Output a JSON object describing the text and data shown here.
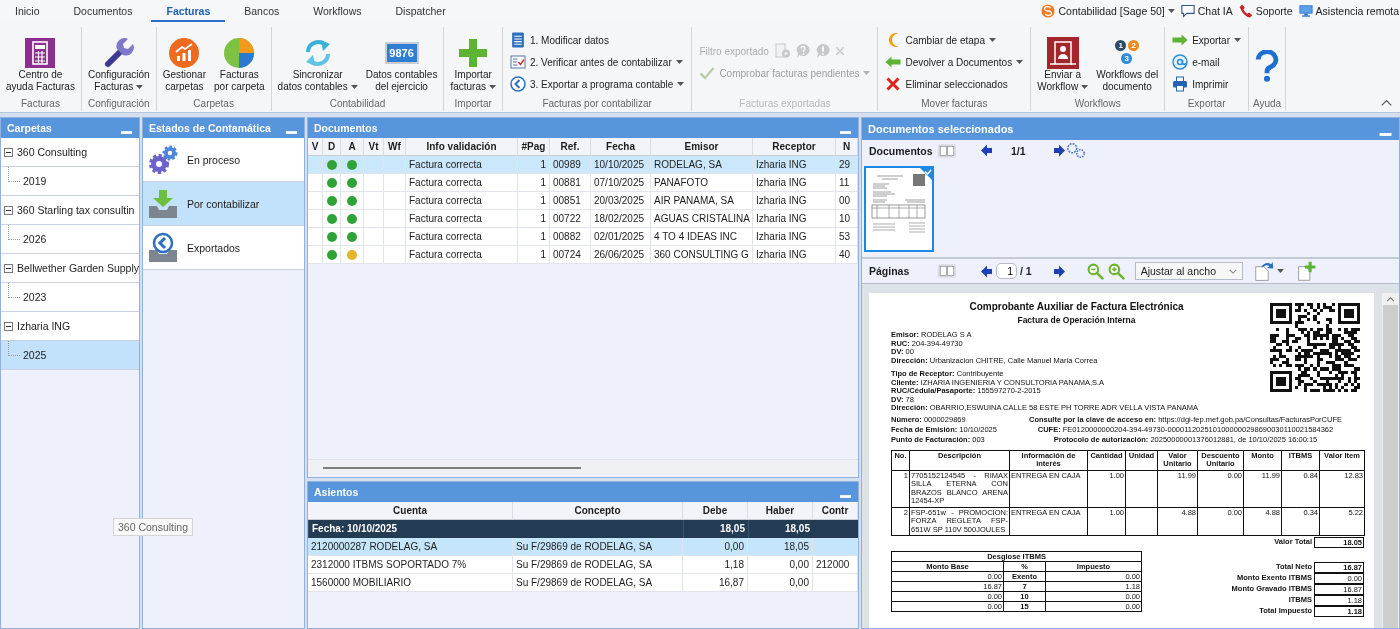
{
  "top_tabs": [
    {
      "label": "Inicio",
      "selected": false
    },
    {
      "label": "Documentos",
      "selected": false
    },
    {
      "label": "Facturas",
      "selected": true
    },
    {
      "label": "Bancos",
      "selected": false
    },
    {
      "label": "Workflows",
      "selected": false
    },
    {
      "label": "Dispatcher",
      "selected": false
    }
  ],
  "top_links": [
    {
      "label": "Contabilidad [Sage 50]",
      "dropdown": true
    },
    {
      "label": "Chat IA",
      "dropdown": false
    },
    {
      "label": "Soporte",
      "dropdown": false
    },
    {
      "label": "Asistencia remota",
      "dropdown": false
    }
  ],
  "ribbon": {
    "groups": [
      {
        "label": "Facturas",
        "disabled": false,
        "items": [
          {
            "kind": "large",
            "lines": [
              "Centro de",
              "ayuda Facturas"
            ],
            "dropdown": false
          }
        ]
      },
      {
        "label": "Configuración",
        "disabled": false,
        "items": [
          {
            "kind": "large",
            "lines": [
              "Configuración",
              "Facturas"
            ],
            "dropdown": true
          }
        ]
      },
      {
        "label": "Carpetas",
        "disabled": false,
        "items": [
          {
            "kind": "large",
            "lines": [
              "Gestionar",
              "carpetas"
            ],
            "dropdown": false
          },
          {
            "kind": "large",
            "lines": [
              "Facturas",
              "por carpeta"
            ],
            "dropdown": false
          }
        ]
      },
      {
        "label": "Contabilidad",
        "disabled": false,
        "items": [
          {
            "kind": "large",
            "lines": [
              "Sincronizar",
              "datos contables"
            ],
            "dropdown": true
          },
          {
            "kind": "large",
            "display": "9876",
            "lines": [
              "Datos contables",
              "del ejercicio"
            ],
            "dropdown": false
          }
        ]
      },
      {
        "label": "Importar",
        "disabled": false,
        "items": [
          {
            "kind": "large",
            "lines": [
              "Importar",
              "facturas"
            ],
            "dropdown": true
          }
        ]
      },
      {
        "label": "Facturas por contabilizar",
        "disabled": false,
        "items": [
          {
            "kind": "small",
            "label": "1. Modificar datos",
            "dropdown": false
          },
          {
            "kind": "small",
            "label": "2. Verificar antes de contabilizar",
            "dropdown": true
          },
          {
            "kind": "small",
            "label": "3. Exportar a programa contable",
            "dropdown": true
          }
        ]
      },
      {
        "label": "Facturas exportadas",
        "disabled": true,
        "items": [
          {
            "kind": "tools",
            "label": "Filtro exportado",
            "dropdown": false
          },
          {
            "kind": "small",
            "label": "Comprobar facturas pendientes",
            "dropdown": true
          }
        ]
      },
      {
        "label": "Mover facturas",
        "disabled": false,
        "items": [
          {
            "kind": "small",
            "label": "Cambiar de etapa",
            "dropdown": true
          },
          {
            "kind": "small",
            "label": "Devolver a Documentos",
            "dropdown": true
          },
          {
            "kind": "small",
            "label": "Eliminar seleccionados",
            "dropdown": false
          }
        ]
      },
      {
        "label": "Workflows",
        "disabled": false,
        "items": [
          {
            "kind": "large",
            "lines": [
              "Enviar a",
              "Workflow"
            ],
            "dropdown": true
          },
          {
            "kind": "large",
            "badges": [
              "1",
              "2",
              "3"
            ],
            "lines": [
              "Workflows del",
              "documento"
            ],
            "dropdown": false
          }
        ]
      },
      {
        "label": "Exportar",
        "disabled": false,
        "items": [
          {
            "kind": "small",
            "label": "Exportar",
            "dropdown": true
          },
          {
            "kind": "small",
            "label": "e-mail",
            "dropdown": false
          },
          {
            "kind": "small",
            "label": "Imprimir",
            "dropdown": false
          }
        ]
      },
      {
        "label": "Ayuda",
        "disabled": false,
        "items": [
          {
            "kind": "icon",
            "dropdown": false
          }
        ]
      }
    ]
  },
  "carpetas": {
    "title": "Carpetas",
    "tree": [
      {
        "label": "360 Consulting",
        "expanded": true,
        "selected": false,
        "children": [
          {
            "label": "2019",
            "selected": false
          }
        ]
      },
      {
        "label": "360 Starling tax consultin",
        "expanded": true,
        "selected": false,
        "children": [
          {
            "label": "2026",
            "selected": false
          }
        ]
      },
      {
        "label": "Bellwether Garden Supply",
        "expanded": true,
        "selected": false,
        "children": [
          {
            "label": "2023",
            "selected": false
          }
        ]
      },
      {
        "label": "Izharia ING",
        "expanded": true,
        "selected": false,
        "children": [
          {
            "label": "2025",
            "selected": true
          }
        ]
      }
    ]
  },
  "estados": {
    "title": "Estados de Contamática",
    "items": [
      {
        "label": "En proceso",
        "selected": false
      },
      {
        "label": "Por contabilizar",
        "selected": true
      },
      {
        "label": "Exportados",
        "selected": false
      }
    ]
  },
  "documentos": {
    "title": "Documentos",
    "columns": [
      "V",
      "D",
      "A",
      "Vt",
      "Wf",
      "Info validación",
      "#Pag",
      "Ref.",
      "Fecha",
      "Emisor",
      "Receptor",
      "N"
    ],
    "rows": [
      {
        "selected": true,
        "dots": [
          {
            "color": "#2fa336"
          },
          {
            "color": "#2fa336"
          }
        ],
        "info": "Factura correcta",
        "pag": "1",
        "ref": "00989",
        "fecha": "10/10/2025",
        "emisor": "RODELAG, SA",
        "receptor": "Izharia ING",
        "column_12": "29"
      },
      {
        "selected": false,
        "dots": [
          {
            "color": "#2fa336"
          },
          {
            "color": "#2fa336"
          }
        ],
        "info": "Factura correcta",
        "pag": "1",
        "ref": "00881",
        "fecha": "07/10/2025",
        "emisor": "PANAFOTO",
        "receptor": "Izharia ING",
        "column_12": "11"
      },
      {
        "selected": false,
        "dots": [
          {
            "color": "#2fa336"
          },
          {
            "color": "#2fa336"
          }
        ],
        "info": "Factura correcta",
        "pag": "1",
        "ref": "00851",
        "fecha": "20/03/2025",
        "emisor": "AIR PANAMA, SA",
        "receptor": "Izharia ING",
        "column_12": "00"
      },
      {
        "selected": false,
        "dots": [
          {
            "color": "#2fa336"
          },
          {
            "color": "#2fa336"
          }
        ],
        "info": "Factura correcta",
        "pag": "1",
        "ref": "00722",
        "fecha": "18/02/2025",
        "emisor": "AGUAS CRISTALINA",
        "receptor": "Izharia ING",
        "column_12": "10"
      },
      {
        "selected": false,
        "dots": [
          {
            "color": "#2fa336"
          },
          {
            "color": "#2fa336"
          }
        ],
        "info": "Factura correcta",
        "pag": "1",
        "ref": "00882",
        "fecha": "02/01/2025",
        "emisor": "4 TO 4 IDEAS INC",
        "receptor": "Izharia ING",
        "column_12": "53"
      },
      {
        "selected": false,
        "dots": [
          {
            "color": "#2fa336"
          },
          {
            "color": "#e2b52a"
          }
        ],
        "info": "Factura correcta",
        "pag": "1",
        "ref": "00724",
        "fecha": "26/06/2025",
        "emisor": "360 CONSULTING G",
        "receptor": "Izharia ING",
        "column_12": "40"
      }
    ]
  },
  "asientos": {
    "title": "Asientos",
    "columns": [
      "Cuenta",
      "Concepto",
      "Debe",
      "Haber",
      "Contr"
    ],
    "group": {
      "label": "Fecha: 10/10/2025",
      "debe": "18,05",
      "haber": "18,05"
    },
    "rows": [
      {
        "selected": true,
        "cuenta": "2120000287 RODELAG, SA",
        "concepto": "Su F/29869 de RODELAG, SA",
        "debe": "0,00",
        "haber": "18,05"
      },
      {
        "selected": false,
        "cuenta": "2312000 ITBMS SOPORTADO 7%",
        "concepto": "Su F/29869 de RODELAG, SA",
        "debe": "1,18",
        "haber": "0,00",
        "contr": "212000"
      },
      {
        "selected": false,
        "cuenta": "1560000 MOBILIARIO",
        "concepto": "Su F/29869 de RODELAG, SA",
        "debe": "16,87",
        "haber": "0,00"
      }
    ]
  },
  "tooltip": {
    "text": "360 Consulting"
  },
  "selected_documents": {
    "title": "Documentos seleccionados",
    "documents_label": "Documentos",
    "document_counter": "1/1",
    "thumbnails": [
      {
        "selected": true
      }
    ],
    "pages_label": "Páginas",
    "page": "1",
    "page_total": "/ 1",
    "zoom_mode": "Ajustar al ancho"
  },
  "preview": {
    "title": "Comprobante Auxiliar de Factura Electrónica",
    "subtitle": "Factura de Operación Interna",
    "issuer_lines": [
      "**Emisor:** RODELAG S A",
      "**RUC:** 204-394-49730",
      "**DV:** 00",
      "**Dirección:** Urbanizacion CHITRE, Calle Manuel Maria Correa"
    ],
    "receiver_lines": [
      "**Tipo de Receptor:** Contribuyente",
      "**Cliente:** IZHARIA INGENIERIA Y CONSULTORIA PANAMA,S.A",
      "**RUC/Cédula/Pasaporte:** 155597270-2-2015",
      "**DV:** 78",
      "**Dirección:** OBARRIO,ESWUINA CALLE 58 ESTE PH TORRE ADR VELLA VISTA PANAMA"
    ],
    "meta_left": [
      "**Número:** 0000029869",
      "**Fecha de Emisión:** 10/10/2025",
      "**Punto de Facturación:** 003"
    ],
    "meta_right": [
      "**Consulte por la clave de acceso en:** https://dgi-fep.mef.gob.pa/Consultas/FacturasPorCUFE",
      "**CUFE:** FE0120000000204-394-49730-0000112025101000000298690030110021584362",
      "**Protocolo de autorización:** 20250000001376012881, de 10/10/2025 16:00:15"
    ],
    "items_table": {
      "columns": [
        "No.",
        "Descripción",
        "Información de interés",
        "Cantidad",
        "Unidad",
        "Valor Unitario",
        "Descuento Unitario",
        "Monto",
        "ITBMS",
        "Valor Item"
      ],
      "rows": [
        {
          "no": "1",
          "descripcion": "7705152124545 - RIMAX SILLA ETERNA CON BRAZOS BLANCO ARENA 12454-XP",
          "informacion": "ENTREGA EN CAJA",
          "cantidad": "1.00",
          "valor_unitario": "11.99",
          "descuento_unitario": "0.00",
          "monto": "11.99",
          "itbms": "0.84",
          "valor_item": "12.83"
        },
        {
          "no": "2",
          "descripcion": "FSP-651w - PROMOCION: FORZA REGLETA FSP-651W SP 110V 500JOULES",
          "informacion": "ENTREGA EN CAJA",
          "cantidad": "1.00",
          "valor_unitario": "4.88",
          "descuento_unitario": "0.00",
          "monto": "4.88",
          "itbms": "0.34",
          "valor_item": "5.22"
        }
      ]
    },
    "total": {
      "label": "Valor Total",
      "value": "18.05"
    },
    "itbms_breakdown": {
      "title": "Desglose ITBMS",
      "columns": [
        "Monto Base",
        "%",
        "Impuesto"
      ],
      "rows": [
        {
          "base": "0.00",
          "rate": "Exento",
          "tax": "0.00"
        },
        {
          "base": "16.87",
          "rate": "7",
          "tax": "1.18"
        },
        {
          "base": "0.00",
          "rate": "10",
          "tax": "0.00"
        },
        {
          "base": "0.00",
          "rate": "15",
          "tax": "0.00"
        }
      ]
    },
    "totals": [
      {
        "label": "Total Neto",
        "value": "16.87",
        "bold": true
      },
      {
        "label": "Monto Exento ITBMS",
        "value": "0.00",
        "bold": false
      },
      {
        "label": "Monto Gravado ITBMS",
        "value": "16.87",
        "bold": false
      },
      {
        "label": "ITBMS",
        "value": "1.18",
        "bold": false
      },
      {
        "label": "Total Impuesto",
        "value": "1.18",
        "bold": true
      }
    ]
  }
}
